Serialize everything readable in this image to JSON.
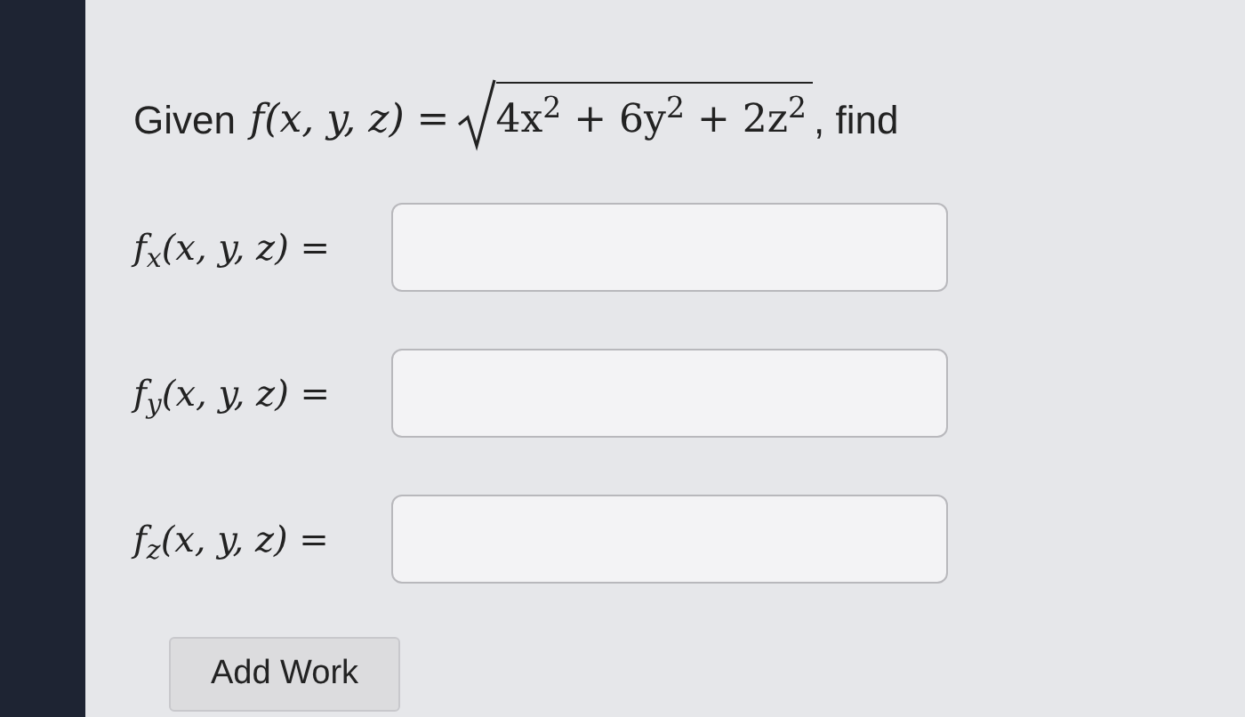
{
  "question": {
    "lead": "Given",
    "function": "f(x, y, z) =",
    "radicand": "4x$^{2}$ + 6y$^{2}$ + 2z$^{2}$",
    "tail": ", find"
  },
  "answers": [
    {
      "label": "f$_{x}$(x, y, z) ="
    },
    {
      "label": "f$_{y}$(x, y, z) ="
    },
    {
      "label": "f$_{z}$(x, y, z) ="
    }
  ],
  "button": "Add Work"
}
